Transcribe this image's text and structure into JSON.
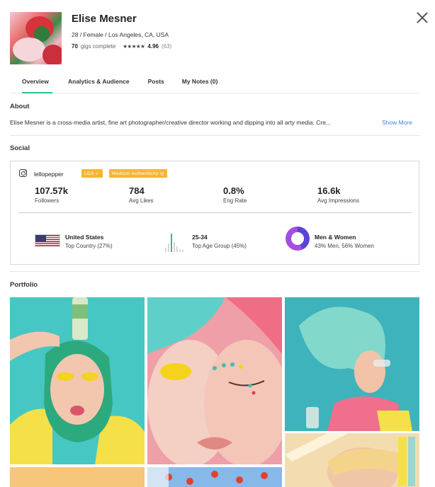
{
  "profile": {
    "name": "Elise Mesner",
    "meta": "28 / Female / Los Angeles, CA, USA",
    "gigs_count": "70",
    "gigs_label": "gigs complete",
    "stars": "★★★★★",
    "rating": "4.96",
    "rating_count": "(63)"
  },
  "tabs": {
    "overview": "Overview",
    "analytics": "Analytics & Audience",
    "posts": "Posts",
    "notes": "My Notes (0)"
  },
  "about": {
    "title": "About",
    "text": "Elise Mesner is a cross-media artist, fine art photographer/creative director working and dipping into all arty media. Cre...",
    "show_more": "Show More"
  },
  "social": {
    "title": "Social",
    "handle": "lellopepper",
    "badge_lda": "LDA ✓",
    "badge_auth": "Medium Authenticity ◎",
    "stats": [
      {
        "value": "107.57k",
        "label": "Followers"
      },
      {
        "value": "784",
        "label": "Avg Likes"
      },
      {
        "value": "0.8%",
        "label": "Eng Rate"
      },
      {
        "value": "16.6k",
        "label": "Avg Impressions"
      }
    ],
    "audience": {
      "country_title": "United States",
      "country_sub": "Top Country (27%)",
      "age_title": "25-34",
      "age_sub": "Top Age Group (45%)",
      "gender_title": "Men & Women",
      "gender_sub": "43% Men, 56% Women"
    },
    "colors": {
      "accent": "#2bbf95",
      "badge": "#f5b731",
      "men": "#5b43d6",
      "women": "#a54de0"
    }
  },
  "portfolio": {
    "title": "Portfolio"
  }
}
